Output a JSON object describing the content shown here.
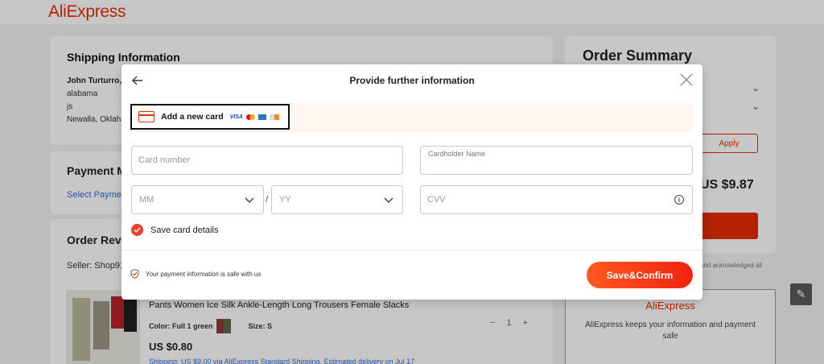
{
  "app": {
    "logo": "AliExpress"
  },
  "background": {
    "shipping": {
      "title": "Shipping Information",
      "name": "John Turturro,",
      "lines": [
        "alabama",
        "js",
        "Newalla, Oklah"
      ]
    },
    "payment": {
      "title": "Payment M",
      "select_link": "Select Payme"
    },
    "review": {
      "title": "Order Revi",
      "seller": "Seller: Shop91",
      "product": {
        "title": "Pants Women Ice Silk Ankle-Length Long Trousers Female Slacks",
        "color_label": "Color: Full 1 green",
        "size_label": "Size: S",
        "price": "US $0.80",
        "shipping": "Shipping: US $9.00 via AliExpress Standard Shipping. Estimated delivery on Jul 17",
        "qty": "1",
        "qty_minus": "−",
        "qty_plus": "+"
      }
    },
    "summary": {
      "title": "Order Summary",
      "apply_label": "Apply",
      "total": "US $9.87",
      "note": "and acknowledged all"
    },
    "safe_card": {
      "logo": "AliExpress",
      "text": "AliExpress keeps your information and payment safe"
    }
  },
  "modal": {
    "title": "Provide further information",
    "new_card_label": "Add a new card",
    "brands": {
      "visa": "VISA"
    },
    "card_number_placeholder": "Card number",
    "cardholder_label": "Cardholder Name",
    "month_placeholder": "MM",
    "year_placeholder": "YY",
    "date_separator": "/",
    "cvv_placeholder": "CVV",
    "info_glyph": "i",
    "save_card_label": "Save card details",
    "secure_text": "Your payment information is safe with us",
    "confirm_label": "Save&Confirm"
  },
  "colors": {
    "accent": "#e62e04",
    "confirm_gradient_start": "#ff5a1f",
    "confirm_gradient_end": "#f0230e"
  }
}
